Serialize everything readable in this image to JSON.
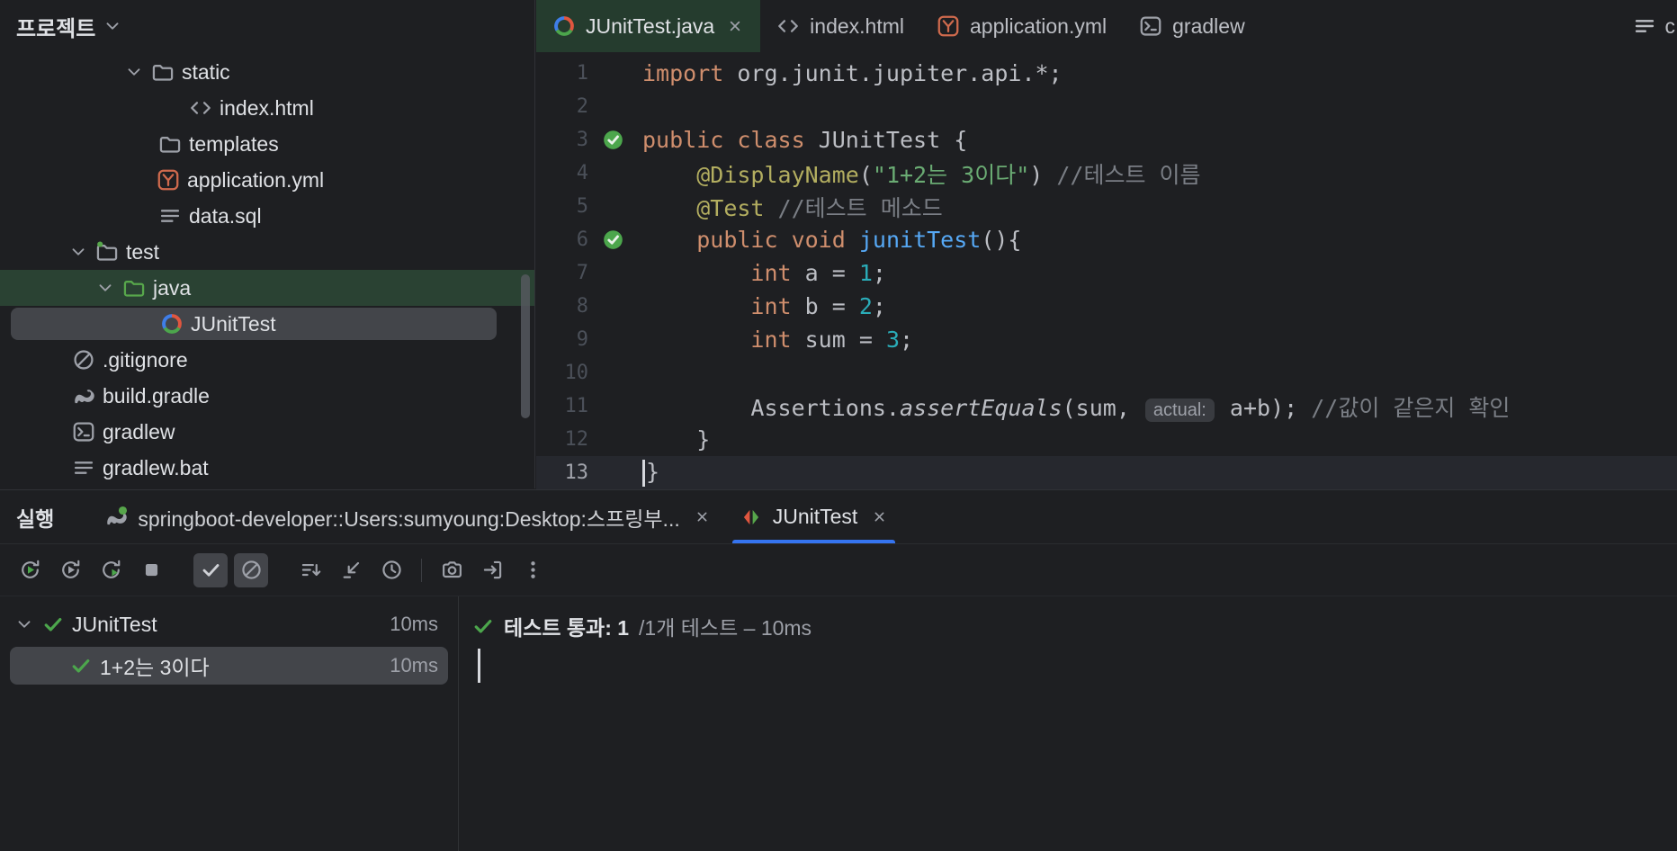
{
  "project_panel": {
    "header": {
      "title": "프로젝트"
    },
    "tree": [
      {
        "name": "static",
        "icon": "folder",
        "indent": 138,
        "chevron": true
      },
      {
        "name": "index.html",
        "icon": "html",
        "indent": 210
      },
      {
        "name": "templates",
        "icon": "folder",
        "indent": 176
      },
      {
        "name": "application.yml",
        "icon": "yml",
        "indent": 174
      },
      {
        "name": "data.sql",
        "icon": "textfile",
        "indent": 176
      },
      {
        "name": "test",
        "icon": "folder-test",
        "indent": 76,
        "chevron": true
      },
      {
        "name": "java",
        "icon": "folder-green",
        "indent": 106,
        "chevron": true,
        "highlight": "green"
      },
      {
        "name": "JUnitTest",
        "icon": "junit",
        "indent": 178,
        "selected": true
      },
      {
        "name": ".gitignore",
        "icon": "ignore",
        "indent": 80
      },
      {
        "name": "build.gradle",
        "icon": "gradle",
        "indent": 80
      },
      {
        "name": "gradlew",
        "icon": "terminal",
        "indent": 80
      },
      {
        "name": "gradlew.bat",
        "icon": "textfile",
        "indent": 80
      }
    ]
  },
  "editor": {
    "tabs": [
      {
        "label": "JUnitTest.java",
        "icon": "junit",
        "active": true,
        "close": true
      },
      {
        "label": "index.html",
        "icon": "html"
      },
      {
        "label": "application.yml",
        "icon": "yml"
      },
      {
        "label": "gradlew",
        "icon": "terminal"
      }
    ],
    "overflow_label": "c",
    "lines": [
      {
        "n": 1,
        "tokens": [
          [
            "kw",
            "import"
          ],
          [
            "pl",
            " org.junit.jupiter.api.*;"
          ]
        ]
      },
      {
        "n": 2,
        "tokens": []
      },
      {
        "n": 3,
        "gutter": "test-pass",
        "tokens": [
          [
            "kw",
            "public class"
          ],
          [
            "pl",
            " JUnitTest {"
          ]
        ]
      },
      {
        "n": 4,
        "tokens": [
          [
            "pl",
            "    "
          ],
          [
            "ann",
            "@DisplayName"
          ],
          [
            "pl",
            "("
          ],
          [
            "str",
            "\"1+2는 3이다\""
          ],
          [
            "pl",
            ") "
          ],
          [
            "cmt",
            "//테스트 이름"
          ]
        ]
      },
      {
        "n": 5,
        "tokens": [
          [
            "pl",
            "    "
          ],
          [
            "ann",
            "@Test"
          ],
          [
            "pl",
            " "
          ],
          [
            "cmt",
            "//테스트 메소드"
          ]
        ]
      },
      {
        "n": 6,
        "gutter": "test-pass",
        "tokens": [
          [
            "pl",
            "    "
          ],
          [
            "kw",
            "public void"
          ],
          [
            "pl",
            " "
          ],
          [
            "fn",
            "junitTest"
          ],
          [
            "pl",
            "(){"
          ]
        ]
      },
      {
        "n": 7,
        "tokens": [
          [
            "pl",
            "        "
          ],
          [
            "kw",
            "int"
          ],
          [
            "pl",
            " a = "
          ],
          [
            "num",
            "1"
          ],
          [
            "pl",
            ";"
          ]
        ]
      },
      {
        "n": 8,
        "tokens": [
          [
            "pl",
            "        "
          ],
          [
            "kw",
            "int"
          ],
          [
            "pl",
            " b = "
          ],
          [
            "num",
            "2"
          ],
          [
            "pl",
            ";"
          ]
        ]
      },
      {
        "n": 9,
        "tokens": [
          [
            "pl",
            "        "
          ],
          [
            "kw",
            "int"
          ],
          [
            "pl",
            " sum = "
          ],
          [
            "num",
            "3"
          ],
          [
            "pl",
            ";"
          ]
        ]
      },
      {
        "n": 10,
        "tokens": []
      },
      {
        "n": 11,
        "tokens": [
          [
            "pl",
            "        Assertions."
          ],
          [
            "it",
            "assertEquals"
          ],
          [
            "pl",
            "(sum, "
          ],
          [
            "hint",
            "actual:"
          ],
          [
            "pl",
            " a+b); "
          ],
          [
            "cmt",
            "//값이 같은지 확인"
          ]
        ]
      },
      {
        "n": 12,
        "tokens": [
          [
            "pl",
            "    }"
          ]
        ]
      },
      {
        "n": 13,
        "caret": true,
        "tokens": [
          [
            "pl",
            "}"
          ]
        ]
      }
    ]
  },
  "run_panel": {
    "title": "실행",
    "tabs": [
      {
        "label": "springboot-developer::Users:sumyoung:Desktop:스프링부...",
        "icon": "gradle-run",
        "close": true
      },
      {
        "label": "JUnitTest",
        "icon": "junit-run",
        "close": true,
        "active": true
      }
    ],
    "toolbar": [
      {
        "icon": "rerun",
        "name": "rerun-tests"
      },
      {
        "icon": "rerun-failed",
        "name": "rerun-failed-tests"
      },
      {
        "icon": "auto-rerun",
        "name": "toggle-auto-test"
      },
      {
        "icon": "stop",
        "name": "stop"
      },
      {
        "gap": true
      },
      {
        "icon": "check",
        "name": "show-passed",
        "toggled": true
      },
      {
        "icon": "ignore",
        "name": "show-ignored",
        "toggled": true
      },
      {
        "gap": true
      },
      {
        "icon": "sort",
        "name": "sort-tests"
      },
      {
        "icon": "collapse",
        "name": "collapse-all"
      },
      {
        "icon": "clock",
        "name": "sort-by-duration"
      },
      {
        "sep": true
      },
      {
        "icon": "camera",
        "name": "screenshot"
      },
      {
        "icon": "import",
        "name": "import-test-results"
      },
      {
        "icon": "kebab",
        "name": "more-options"
      }
    ],
    "results": [
      {
        "label": "JUnitTest",
        "time": "10ms",
        "indent": 16,
        "chevron": true,
        "status": "passed"
      },
      {
        "label": "1+2는 3이다",
        "time": "10ms",
        "indent": 78,
        "status": "passed",
        "selected": true
      }
    ],
    "output": {
      "status": "테스트 통과: 1",
      "detail": "/1개 테스트 – 10ms"
    }
  }
}
